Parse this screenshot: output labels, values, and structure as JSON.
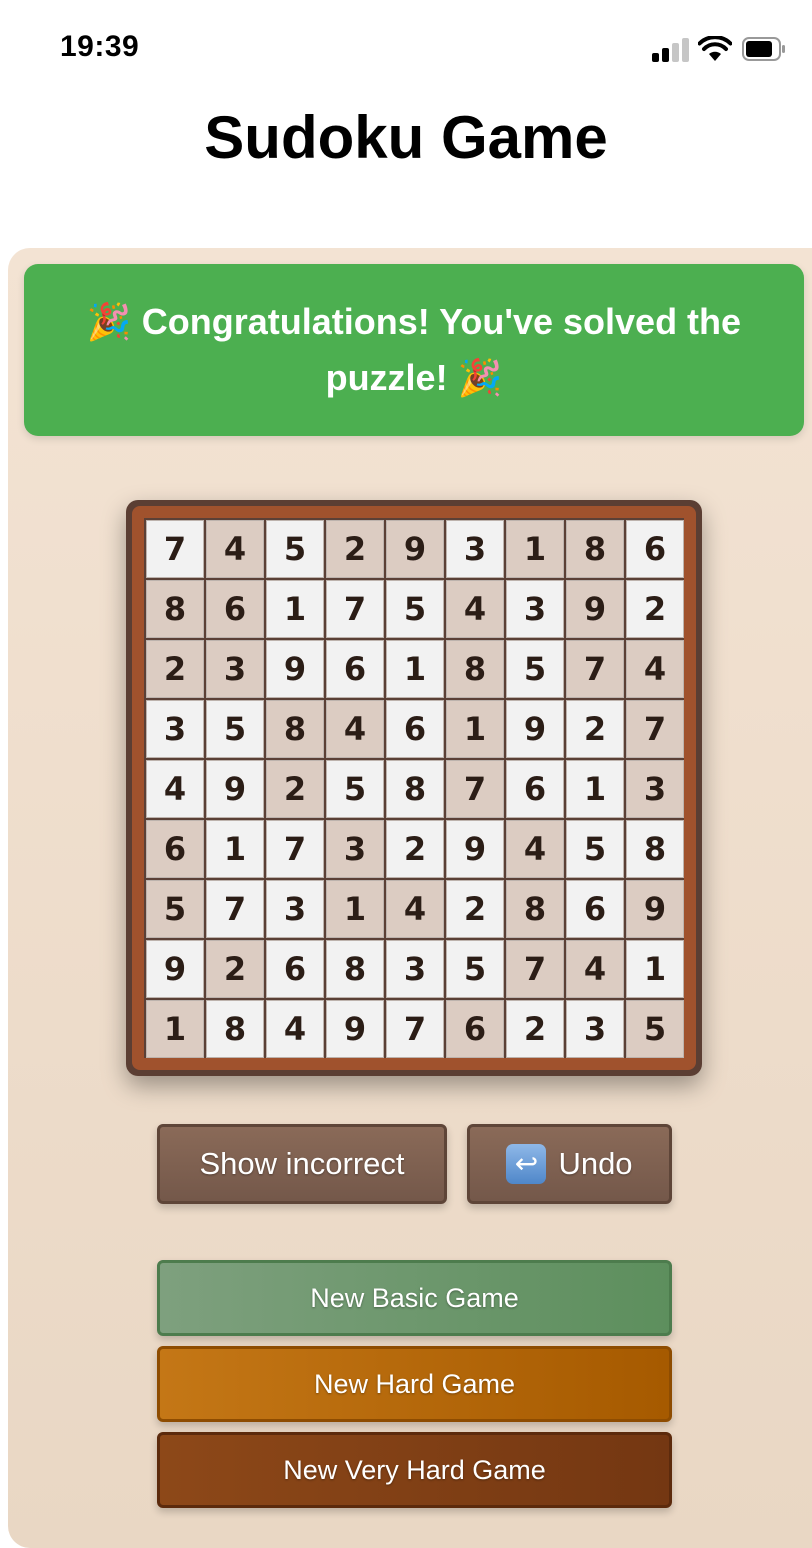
{
  "status_bar": {
    "time": "19:39",
    "signal_icon": "cellular-signal-icon",
    "wifi_icon": "wifi-icon",
    "battery_icon": "battery-icon"
  },
  "title": "Sudoku Game",
  "banner": {
    "text": "🎉 Congratulations! You've solved the puzzle! 🎉",
    "color": "#4caf50"
  },
  "board": {
    "size": 9,
    "values": [
      [
        7,
        4,
        5,
        2,
        9,
        3,
        1,
        8,
        6
      ],
      [
        8,
        6,
        1,
        7,
        5,
        4,
        3,
        9,
        2
      ],
      [
        2,
        3,
        9,
        6,
        1,
        8,
        5,
        7,
        4
      ],
      [
        3,
        5,
        8,
        4,
        6,
        1,
        9,
        2,
        7
      ],
      [
        4,
        9,
        2,
        5,
        8,
        7,
        6,
        1,
        3
      ],
      [
        6,
        1,
        7,
        3,
        2,
        9,
        4,
        5,
        8
      ],
      [
        5,
        7,
        3,
        1,
        4,
        2,
        8,
        6,
        9
      ],
      [
        9,
        2,
        6,
        8,
        3,
        5,
        7,
        4,
        1
      ],
      [
        1,
        8,
        4,
        9,
        7,
        6,
        2,
        3,
        5
      ]
    ],
    "shading": [
      [
        0,
        1,
        0,
        1,
        1,
        0,
        1,
        1,
        0
      ],
      [
        1,
        1,
        0,
        0,
        0,
        1,
        0,
        1,
        0
      ],
      [
        1,
        1,
        0,
        0,
        0,
        1,
        0,
        1,
        1
      ],
      [
        0,
        0,
        1,
        1,
        0,
        1,
        0,
        0,
        1
      ],
      [
        0,
        0,
        1,
        0,
        0,
        1,
        0,
        0,
        1
      ],
      [
        1,
        0,
        0,
        1,
        0,
        0,
        1,
        0,
        0
      ],
      [
        1,
        0,
        0,
        1,
        1,
        0,
        1,
        0,
        1
      ],
      [
        0,
        1,
        0,
        0,
        0,
        0,
        1,
        1,
        0
      ],
      [
        1,
        0,
        0,
        0,
        0,
        1,
        0,
        0,
        1
      ]
    ],
    "colors": {
      "given": "#dcccc2",
      "filled": "#f2f2f2",
      "frame": "#a0522d"
    }
  },
  "buttons": {
    "show_incorrect": "Show incorrect",
    "undo": "Undo",
    "undo_icon": "undo-arrow-icon",
    "new_basic": "New Basic Game",
    "new_hard": "New Hard Game",
    "new_very_hard": "New Very Hard Game"
  }
}
